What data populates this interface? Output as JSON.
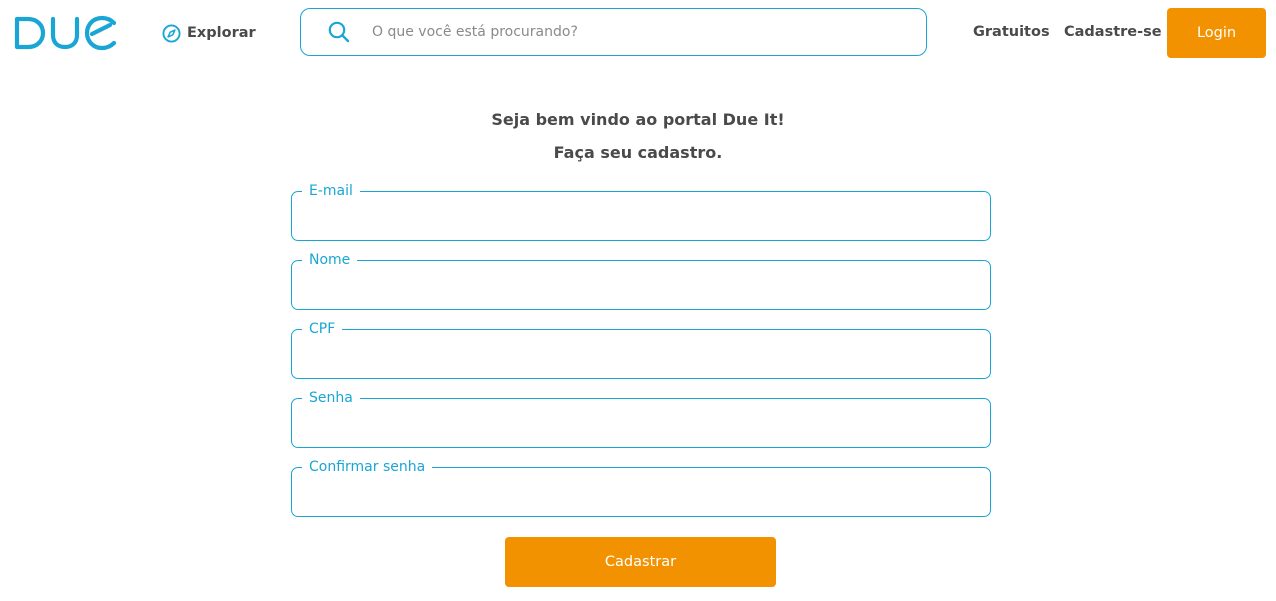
{
  "colors": {
    "brand_blue": "#1aa6d4",
    "accent_orange": "#f39200",
    "text_dark": "#4a4a4a",
    "placeholder": "#8a8a8a"
  },
  "header": {
    "logo_text": "Due",
    "explore": {
      "icon": "compass-icon",
      "label": "Explorar"
    },
    "search": {
      "icon": "search-icon",
      "placeholder": "O que você está procurando?",
      "value": ""
    },
    "nav": {
      "free_label": "Gratuitos",
      "signup_label": "Cadastre-se",
      "login_label": "Login"
    }
  },
  "signup": {
    "welcome": "Seja bem vindo ao portal Due It!",
    "subtitle": "Faça seu cadastro.",
    "fields": [
      {
        "label": "E-mail",
        "value": ""
      },
      {
        "label": "Nome",
        "value": ""
      },
      {
        "label": "CPF",
        "value": ""
      },
      {
        "label": "Senha",
        "value": ""
      },
      {
        "label": "Confirmar senha",
        "value": ""
      }
    ],
    "submit_label": "Cadastrar"
  }
}
